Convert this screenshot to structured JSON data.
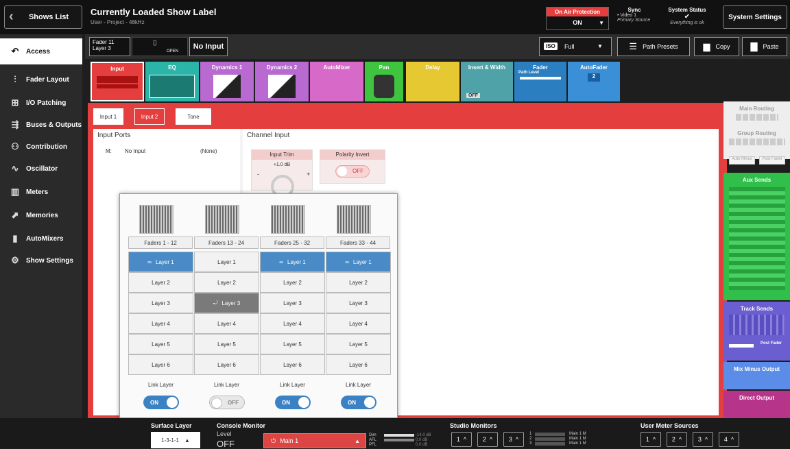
{
  "topbar": {
    "shows_list": "Shows List",
    "show_label": "Currently Loaded Show Label",
    "project": "User - Project - 48kHz",
    "on_air_title": "On Air Protection",
    "on_air_value": "ON",
    "sync_title": "Sync",
    "sync_line1": "• Video 1",
    "sync_line2": "Primary Source",
    "status_title": "System Status",
    "status_check": "✔",
    "status_text": "Everything is ok",
    "system_settings": "System Settings"
  },
  "sidebar": {
    "items": [
      {
        "label": "Access",
        "icon": "arrow-curve-icon"
      },
      {
        "label": "Fader Layout",
        "icon": "fader-icon"
      },
      {
        "label": "I/O Patching",
        "icon": "grid-icon"
      },
      {
        "label": "Buses & Outputs",
        "icon": "bus-icon"
      },
      {
        "label": "Contribution",
        "icon": "contribution-icon"
      },
      {
        "label": "Oscillator",
        "icon": "wave-icon"
      },
      {
        "label": "Meters",
        "icon": "meter-icon"
      },
      {
        "label": "Memories",
        "icon": "memory-icon"
      },
      {
        "label": "AutoMixers",
        "icon": "automixer-icon"
      },
      {
        "label": "Show Settings",
        "icon": "gear-icon"
      }
    ]
  },
  "selection": {
    "fader": "Fader 11",
    "layer": "Layer 3",
    "open": "OPEN",
    "input_name": "No Input",
    "iso": "ISO",
    "mode": "Full",
    "path_presets": "Path Presets",
    "copy": "Copy",
    "paste": "Paste"
  },
  "modules": [
    {
      "label": "Input",
      "color": "#e53e3e"
    },
    {
      "label": "EQ",
      "color": "#2bb5a8"
    },
    {
      "label": "Dynamics 1",
      "color": "#b86ad0"
    },
    {
      "label": "Dynamics 2",
      "color": "#b86ad0"
    },
    {
      "label": "AutoMixer",
      "color": "#d76ac8"
    },
    {
      "label": "Pan",
      "color": "#3fc43f"
    },
    {
      "label": "Delay",
      "color": "#e6c832"
    },
    {
      "label": "Insert & Width",
      "color": "#4fa3a8"
    },
    {
      "label": "Fader",
      "color": "#2b7fc1"
    },
    {
      "label": "AutoFader",
      "color": "#3b8fd6"
    }
  ],
  "module_extra": {
    "insert_off": "OFF",
    "fader_path": "Path Level",
    "autofader_num": "2"
  },
  "tabs": [
    "Input 1",
    "Input 2",
    "Tone"
  ],
  "input_ports": {
    "title": "Input Ports",
    "row_channel": "M:",
    "row_name": "No Input",
    "row_value": "(None)"
  },
  "channel_input": {
    "title": "Channel Input",
    "trim_label": "Input Trim",
    "trim_value": "+1.0 dB",
    "minus": "-",
    "plus": "+",
    "polarity_label": "Polarity Invert",
    "polarity_value": "OFF"
  },
  "popup": {
    "ranges": [
      "Faders 1 - 12",
      "Faders 13 - 24",
      "Faders 25 - 32",
      "Faders 33 - 44"
    ],
    "layers": [
      [
        "Layer 1",
        "Layer 1",
        "Layer 1",
        "Layer 1"
      ],
      [
        "Layer 2",
        "Layer 2",
        "Layer 2",
        "Layer 2"
      ],
      [
        "Layer 3",
        "Layer 3",
        "Layer 3",
        "Layer 3"
      ],
      [
        "Layer 4",
        "Layer 4",
        "Layer 4",
        "Layer 4"
      ],
      [
        "Layer 5",
        "Layer 5",
        "Layer 5",
        "Layer 5"
      ],
      [
        "Layer 6",
        "Layer 6",
        "Layer 6",
        "Layer 6"
      ]
    ],
    "link_label": "Link Layer",
    "links": [
      "ON",
      "OFF",
      "ON",
      "ON"
    ]
  },
  "right_panel": {
    "main_routing": "Main Routing",
    "group_routing": "Group Routing",
    "auto_minus": "Auto Minus",
    "post_fader": "Post Fader",
    "aux_sends": "Aux Sends",
    "track_sends": "Track Sends",
    "track_post_fader": "Post Fader",
    "mix_minus": "Mix Minus Output",
    "direct_output": "Direct Output"
  },
  "bottom": {
    "surface_layer": "Surface Layer",
    "surface_value": "1-3-1-1",
    "console_monitor": "Console Monitor",
    "level": "Level",
    "level_value": "OFF",
    "main_button": "Main 1",
    "dim": "Dim",
    "afl": "AFL",
    "pfl": "PFL",
    "dim_val": "-14.0 dB",
    "afl_val": "0.0 dB",
    "pfl_val": "0.0 dB",
    "studio_monitors": "Studio Monitors",
    "studio_buttons": [
      "1",
      "2",
      "3"
    ],
    "studio_mains": [
      "Main 1 M",
      "Main 1 M",
      "Main 1 M"
    ],
    "studio_nums": [
      "1",
      "2",
      "3"
    ],
    "user_meter": "User Meter Sources",
    "user_buttons": [
      "1",
      "2",
      "3",
      "4"
    ]
  }
}
